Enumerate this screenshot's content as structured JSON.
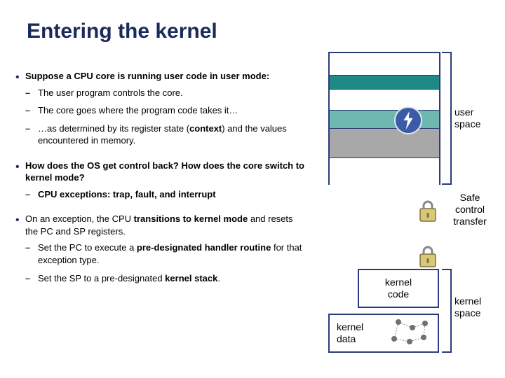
{
  "title": "Entering the kernel",
  "bullets": {
    "b1": {
      "head": "Suppose a CPU core is running user code in user mode:",
      "s1": "The user program controls the core.",
      "s2": "The core goes where the program code takes it…",
      "s3_pre": "…as determined by its register state (",
      "s3_bold": "context",
      "s3_post": ") and the values encountered in memory."
    },
    "b2": {
      "head": "How does the OS get control back?  How does the core switch to kernel mode?",
      "s1": "CPU exceptions: trap, fault, and interrupt"
    },
    "b3": {
      "head_pre": "On an exception, the CPU ",
      "head_bold": "transitions to kernel mode",
      "head_post": " and resets the PC and SP registers.",
      "s1_pre": "Set the PC to execute a ",
      "s1_bold": "pre-designated handler routine",
      "s1_post": " for that exception type.",
      "s2_pre": "Set the SP to a pre-designated ",
      "s2_bold": "kernel stack",
      "s2_post": "."
    }
  },
  "labels": {
    "user_space_l1": "user",
    "user_space_l2": "space",
    "safe_l1": "Safe",
    "safe_l2": "control",
    "safe_l3": "transfer",
    "kernel_code_l1": "kernel",
    "kernel_code_l2": "code",
    "kernel_data_l1": "kernel",
    "kernel_data_l2": "data",
    "kernel_space_l1": "kernel",
    "kernel_space_l2": "space"
  }
}
